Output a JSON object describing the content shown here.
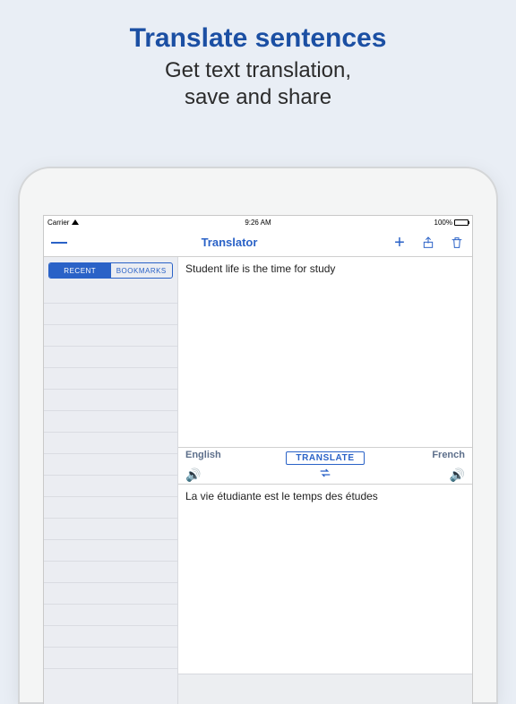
{
  "promo": {
    "title": "Translate sentences",
    "line1": "Get text translation,",
    "line2": "save and share"
  },
  "status": {
    "carrier": "Carrier",
    "time": "9:26 AM",
    "battery_pct": "100%"
  },
  "nav": {
    "title": "Translator"
  },
  "sidebar": {
    "tabs": {
      "recent": "RECENT",
      "bookmarks": "BOOKMARKS"
    }
  },
  "source": {
    "lang_label": "English",
    "text": "Student life is the time for study"
  },
  "target": {
    "lang_label": "French",
    "text": "La vie étudiante est le temps des études"
  },
  "actions": {
    "translate": "TRANSLATE"
  }
}
